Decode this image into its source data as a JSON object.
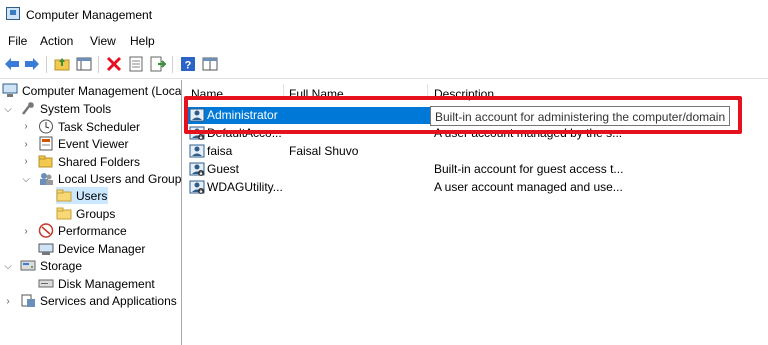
{
  "window": {
    "title": "Computer Management"
  },
  "menu": [
    "File",
    "Action",
    "View",
    "Help"
  ],
  "toolbar": {
    "icons": [
      "back-arrow-icon",
      "forward-arrow-icon",
      "up-folder-icon",
      "show-hide-tree-icon",
      "delete-icon",
      "properties-icon",
      "export-list-icon",
      "help-icon",
      "console-tree-icon"
    ],
    "colors": {
      "back": "#3a7bd5",
      "forward": "#3a7bd5",
      "delete": "#e81123",
      "help": "#2b63c6"
    }
  },
  "tree": {
    "root": "Computer Management (Local",
    "system_tools": "System Tools",
    "task_scheduler": "Task Scheduler",
    "event_viewer": "Event Viewer",
    "shared_folders": "Shared Folders",
    "local_users_groups": "Local Users and Groups",
    "users": "Users",
    "groups": "Groups",
    "performance": "Performance",
    "device_manager": "Device Manager",
    "storage": "Storage",
    "disk_management": "Disk Management",
    "services_apps": "Services and Applications"
  },
  "list": {
    "columns": [
      "Name",
      "Full Name",
      "Description"
    ],
    "rows": [
      {
        "name": "Administrator",
        "full_name": "",
        "description": ""
      },
      {
        "name": "DefaultAcco...",
        "full_name": "",
        "description": "A user account managed by the s..."
      },
      {
        "name": "faisa",
        "full_name": "Faisal Shuvo",
        "description": ""
      },
      {
        "name": "Guest",
        "full_name": "",
        "description": "Built-in account for guest access t..."
      },
      {
        "name": "WDAGUtility...",
        "full_name": "",
        "description": "A user account managed and use..."
      }
    ]
  },
  "tooltip": {
    "text": "Built-in account for administering the computer/domain"
  },
  "colors": {
    "selection": "#0078d7",
    "annotation": "#e5111d",
    "tree_selection": "#cce8ff"
  }
}
